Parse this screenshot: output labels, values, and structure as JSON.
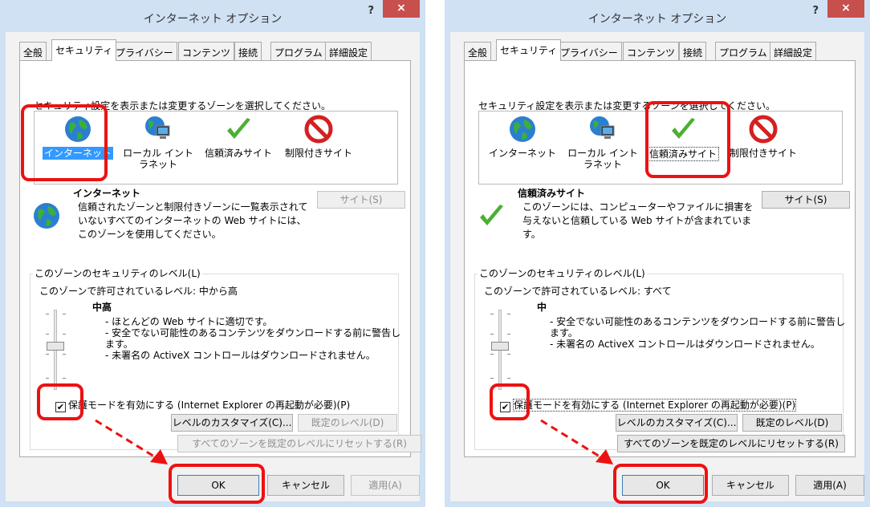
{
  "dialogs": [
    {
      "title": "インターネット オプション",
      "help": "?",
      "close": "×",
      "tabs": [
        "全般",
        "セキュリティ",
        "プライバシー",
        "コンテンツ",
        "接続",
        "プログラム",
        "詳細設定"
      ],
      "select_zone_text": "セキュリティ設定を表示または変更するゾーンを選択してください。",
      "zones": [
        {
          "label": "インターネット",
          "icon": "globe-icon"
        },
        {
          "label": "ローカル イントラネット",
          "icon": "intranet-icon"
        },
        {
          "label": "信頼済みサイト",
          "icon": "checkmark-icon"
        },
        {
          "label": "制限付きサイト",
          "icon": "no-entry-icon"
        }
      ],
      "selected_zone": 0,
      "zone_info": {
        "title": "インターネット",
        "icon": "globe-icon",
        "description": "信頼されたゾーンと制限付きゾーンに一覧表示されていないすべてのインターネットの Web サイトには、このゾーンを使用してください。"
      },
      "sites_button": "サイト(S)",
      "sites_enabled": false,
      "group_label": "このゾーンのセキュリティのレベル(L)",
      "allowed_levels": "このゾーンで許可されているレベル: 中から高",
      "level_name": "中高",
      "level_bullets": [
        "- ほとんどの Web サイトに適切です。",
        "- 安全でない可能性のあるコンテンツをダウンロードする前に警告します。",
        "- 未署名の ActiveX コントロールはダウンロードされません。"
      ],
      "protected_mode": "保護モードを有効にする (Internet Explorer の再起動が必要)(P)",
      "protected_checked": true,
      "custom_level_button": "レベルのカスタマイズ(C)...",
      "default_level_button": "既定のレベル(D)",
      "default_level_enabled": false,
      "reset_all_button": "すべてのゾーンを既定のレベルにリセットする(R)",
      "reset_all_enabled": false,
      "ok_button": "OK",
      "cancel_button": "キャンセル",
      "apply_button": "適用(A)",
      "apply_enabled": false
    },
    {
      "title": "インターネット オプション",
      "help": "?",
      "close": "×",
      "tabs": [
        "全般",
        "セキュリティ",
        "プライバシー",
        "コンテンツ",
        "接続",
        "プログラム",
        "詳細設定"
      ],
      "select_zone_text": "セキュリティ設定を表示または変更するゾーンを選択してください。",
      "zones": [
        {
          "label": "インターネット",
          "icon": "globe-icon"
        },
        {
          "label": "ローカル イントラネット",
          "icon": "intranet-icon"
        },
        {
          "label": "信頼済みサイト",
          "icon": "checkmark-icon"
        },
        {
          "label": "制限付きサイト",
          "icon": "no-entry-icon"
        }
      ],
      "selected_zone": 2,
      "zone_info": {
        "title": "信頼済みサイト",
        "icon": "checkmark-icon",
        "description": "このゾーンには、コンピューターやファイルに損害を与えないと信頼している Web サイトが含まれています。"
      },
      "sites_button": "サイト(S)",
      "sites_enabled": true,
      "group_label": "このゾーンのセキュリティのレベル(L)",
      "allowed_levels": "このゾーンで許可されているレベル: すべて",
      "level_name": "中",
      "level_bullets": [
        "- 安全でない可能性のあるコンテンツをダウンロードする前に警告します。",
        "- 未署名の ActiveX コントロールはダウンロードされません。"
      ],
      "protected_mode": "保護モードを有効にする (Internet Explorer の再起動が必要)(P)",
      "protected_checked": true,
      "custom_level_button": "レベルのカスタマイズ(C)...",
      "default_level_button": "既定のレベル(D)",
      "default_level_enabled": true,
      "reset_all_button": "すべてのゾーンを既定のレベルにリセットする(R)",
      "reset_all_enabled": true,
      "ok_button": "OK",
      "cancel_button": "キャンセル",
      "apply_button": "適用(A)",
      "apply_enabled": true
    }
  ],
  "colors": {
    "highlight": "#ee1111",
    "title_bar": "#cfe1f3",
    "close_button": "#c7504c",
    "selection": "#3399ff"
  }
}
